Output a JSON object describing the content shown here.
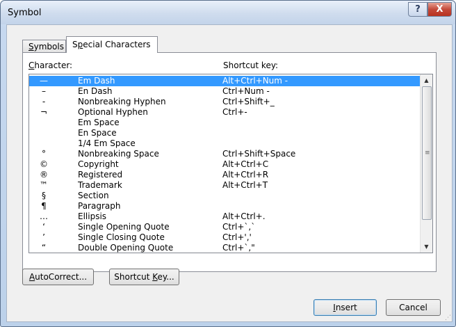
{
  "window": {
    "title": "Symbol",
    "help_label": "?",
    "close_label": "X"
  },
  "tabs": [
    {
      "label": "Symbols",
      "accel": "S",
      "rest": "ymbols",
      "active": false
    },
    {
      "label": "Special Characters",
      "accel": "p",
      "prefix": "S",
      "rest": "ecial Characters",
      "active": true
    }
  ],
  "columns": {
    "character_prefix": "",
    "character_accel": "C",
    "character_rest": "haracter:",
    "shortcut": "Shortcut key:"
  },
  "rows": [
    {
      "symbol": "—",
      "name": "Em Dash",
      "shortcut": "Alt+Ctrl+Num -",
      "selected": true
    },
    {
      "symbol": "–",
      "name": "En Dash",
      "shortcut": "Ctrl+Num -"
    },
    {
      "symbol": "-",
      "name": "Nonbreaking Hyphen",
      "shortcut": "Ctrl+Shift+_"
    },
    {
      "symbol": "¬",
      "name": "Optional Hyphen",
      "shortcut": "Ctrl+-"
    },
    {
      "symbol": "",
      "name": "Em Space",
      "shortcut": ""
    },
    {
      "symbol": "",
      "name": "En Space",
      "shortcut": ""
    },
    {
      "symbol": "",
      "name": "1/4 Em Space",
      "shortcut": ""
    },
    {
      "symbol": "°",
      "name": "Nonbreaking Space",
      "shortcut": "Ctrl+Shift+Space"
    },
    {
      "symbol": "©",
      "name": "Copyright",
      "shortcut": "Alt+Ctrl+C"
    },
    {
      "symbol": "®",
      "name": "Registered",
      "shortcut": "Alt+Ctrl+R"
    },
    {
      "symbol": "™",
      "name": "Trademark",
      "shortcut": "Alt+Ctrl+T"
    },
    {
      "symbol": "§",
      "name": "Section",
      "shortcut": ""
    },
    {
      "symbol": "¶",
      "name": "Paragraph",
      "shortcut": ""
    },
    {
      "symbol": "…",
      "name": "Ellipsis",
      "shortcut": "Alt+Ctrl+."
    },
    {
      "symbol": "‘",
      "name": "Single Opening Quote",
      "shortcut": "Ctrl+`,`"
    },
    {
      "symbol": "’",
      "name": "Single Closing Quote",
      "shortcut": "Ctrl+','"
    },
    {
      "symbol": "“",
      "name": "Double Opening Quote",
      "shortcut": "Ctrl+`,\""
    }
  ],
  "buttons": {
    "autocorrect_accel": "A",
    "autocorrect_rest": "utoCorrect...",
    "shortcut_prefix": "Shortcut ",
    "shortcut_accel": "K",
    "shortcut_rest": "ey...",
    "insert_accel": "I",
    "insert_rest": "nsert",
    "cancel": "Cancel"
  },
  "icons": {
    "scroll_up": "scroll-up-arrow-icon",
    "scroll_down": "scroll-down-arrow-icon",
    "scroll_grip": "scroll-grip-icon",
    "resize": "resize-grip-icon"
  },
  "colors": {
    "selection": "#3399ff",
    "close_button": "#c4493a"
  }
}
